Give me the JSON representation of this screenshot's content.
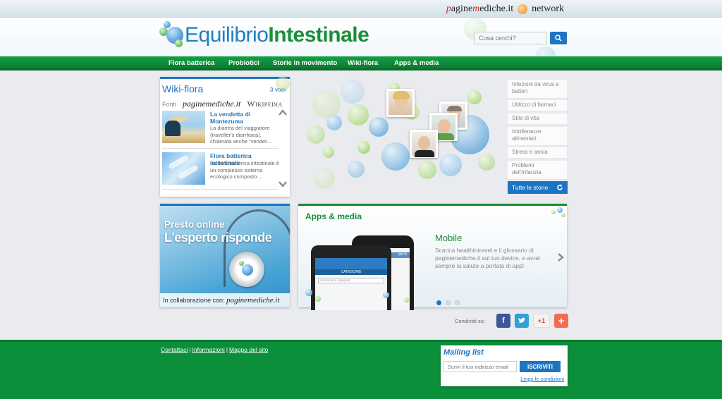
{
  "network": {
    "brand_p": "p",
    "brand_rest": "agine",
    "brand_m": "m",
    "brand_end": "ediche.it",
    "suffix": "network"
  },
  "logo": {
    "part1": "Equilibrio",
    "part2": "Intestinale"
  },
  "search": {
    "placeholder": "Cosa cerchi?",
    "icon": "search-icon"
  },
  "nav": [
    "Flora batterica",
    "Probiotici",
    "Storie in movimento",
    "Wiki-flora",
    "Apps & media"
  ],
  "wiki": {
    "title": "Wiki-flora",
    "count": "3 voci",
    "fonti_label": "Fonti",
    "source1": "paginemediche.it",
    "source2": "Wikipedia",
    "items": [
      {
        "title": "La vendetta di Montezuma",
        "desc": "La diarrea del viaggiatore (traveller's diarrhoea), chiamata anche \"vendet..."
      },
      {
        "title": "Flora batterica intestinale",
        "desc": "La flora batterica intestinale è un complesso sistema ecologico composto ..."
      }
    ]
  },
  "topics": [
    "Infezioni da virus e batteri",
    "Utilizzo di farmaci",
    "Stile di vita",
    "Intolleranze alimentari",
    "Stress e ansia",
    "Problemi dell'infanzia"
  ],
  "all_stories": "Tutte le storie",
  "expert": {
    "line1": "Presto online",
    "line2": "L'esperto risponde",
    "collab": "In collaborazione con:",
    "brand": "paginemediche.it"
  },
  "apps": {
    "title": "Apps & media",
    "subtitle": "Mobile",
    "desc": "Scarica healthintravel e il glossario di paginemediche.it sul tuo device, e avrai sempre la salute a portata di app!",
    "phone_labels": [
      "CATEGORIE",
      "Cerca tra le categorie",
      "per A"
    ]
  },
  "share": {
    "label": "Condividi su:",
    "buttons": [
      "facebook-icon",
      "twitter-icon",
      "google-plus-icon",
      "add-icon"
    ],
    "gplus": "+1"
  },
  "footer": {
    "links": [
      "Contattaci",
      "Informazioni",
      "Mappa del sito"
    ]
  },
  "mailing": {
    "title": "Mailing list",
    "placeholder": "Scrivi il tuo indirizzo email",
    "button": "ISCRIVITI",
    "terms": "Leggi le condizioni"
  },
  "colors": {
    "blue": "#1d75c2",
    "green": "#1b8e3a",
    "footer": "#0c8f3a"
  }
}
